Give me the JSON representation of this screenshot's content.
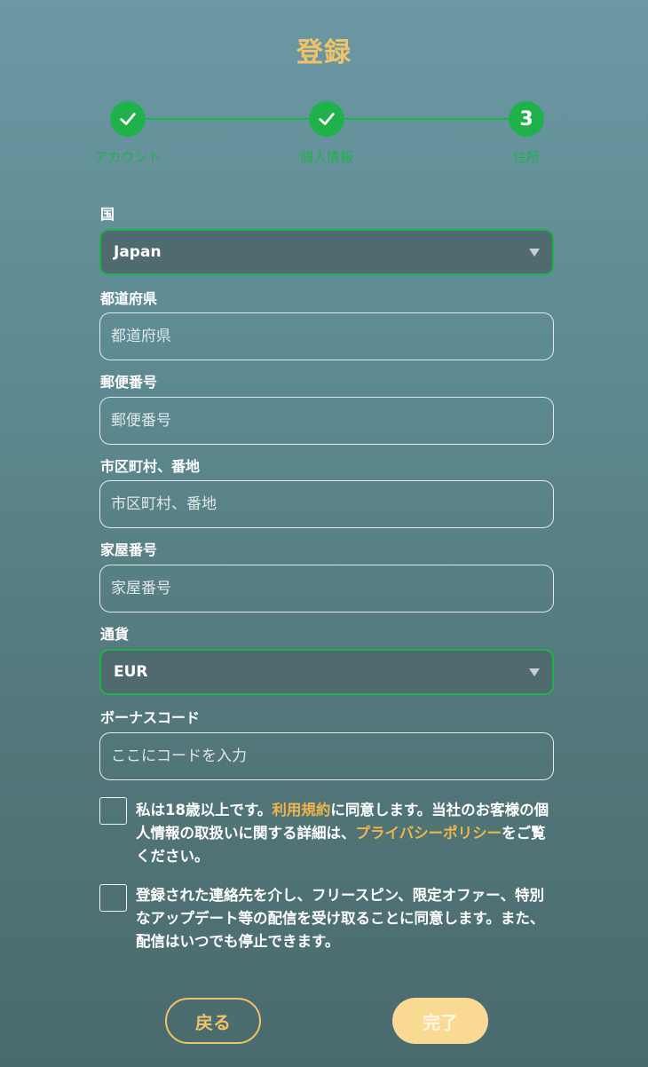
{
  "title": "登録",
  "steps": [
    {
      "label": "アカウント",
      "state": "done",
      "number": ""
    },
    {
      "label": "個人情報",
      "state": "done",
      "number": ""
    },
    {
      "label": "住所",
      "state": "current",
      "number": "3"
    }
  ],
  "form": {
    "country": {
      "label": "国",
      "value": "Japan"
    },
    "prefecture": {
      "label": "都道府県",
      "placeholder": "都道府県"
    },
    "postal": {
      "label": "郵便番号",
      "placeholder": "郵便番号"
    },
    "city": {
      "label": "市区町村、番地",
      "placeholder": "市区町村、番地"
    },
    "house": {
      "label": "家屋番号",
      "placeholder": "家屋番号"
    },
    "currency": {
      "label": "通貨",
      "value": "EUR"
    },
    "bonus": {
      "label": "ボーナスコード",
      "placeholder": "ここにコードを入力"
    }
  },
  "consent1": {
    "prefix": "私は18歳以上です。",
    "terms_link": "利用規約",
    "middle": "に同意します。当社のお客様の個人情報の取扱いに関する詳細は、",
    "privacy_link": "プライバシーポリシー",
    "suffix": "をご覧ください。"
  },
  "consent2": {
    "text": "登録された連絡先を介し、フリースピン、限定オファー、特別なアップデート等の配信を受け取ることに同意します。また、配信はいつでも停止できます。"
  },
  "buttons": {
    "back": "戻る",
    "finish": "完了"
  },
  "colors": {
    "accent": "#f0c36a",
    "step_green": "#1fb24a",
    "link": "#f0b54a"
  }
}
